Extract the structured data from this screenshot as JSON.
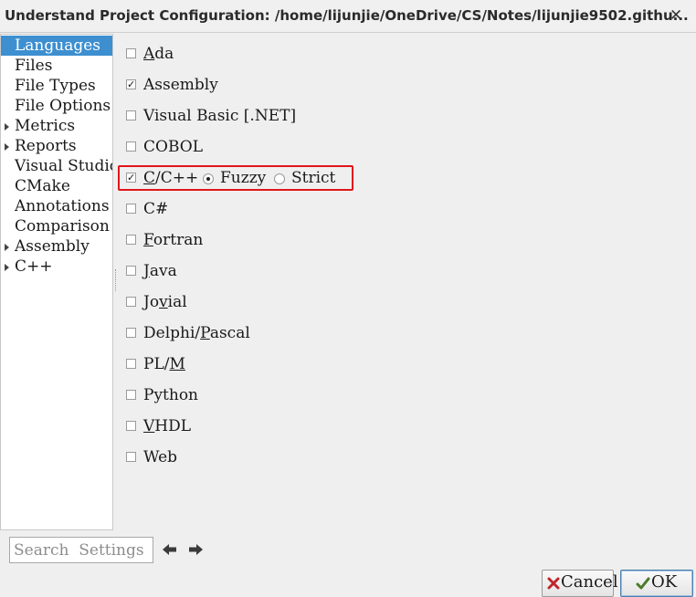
{
  "window": {
    "title": "Understand Project Configuration: /home/lijunjie/OneDrive/CS/Notes/lijunjie9502.githu..."
  },
  "sidebar": {
    "items": [
      {
        "label": "Languages",
        "selected": true,
        "expandable": false
      },
      {
        "label": "Files",
        "selected": false,
        "expandable": false
      },
      {
        "label": "File  Types",
        "selected": false,
        "expandable": false
      },
      {
        "label": "File  Options",
        "selected": false,
        "expandable": false
      },
      {
        "label": "Metrics",
        "selected": false,
        "expandable": true
      },
      {
        "label": "Reports",
        "selected": false,
        "expandable": true
      },
      {
        "label": "Visual  Studio",
        "selected": false,
        "expandable": false
      },
      {
        "label": "CMake",
        "selected": false,
        "expandable": false
      },
      {
        "label": "Annotations",
        "selected": false,
        "expandable": false
      },
      {
        "label": "Comparison",
        "selected": false,
        "expandable": false
      },
      {
        "label": "Assembly",
        "selected": false,
        "expandable": true
      },
      {
        "label": "C++",
        "selected": false,
        "expandable": true
      }
    ]
  },
  "languages": [
    {
      "label": "Ada",
      "checked": false
    },
    {
      "label": "Assembly",
      "checked": true
    },
    {
      "label": "Visual  Basic  [.NET]",
      "checked": false
    },
    {
      "label": "COBOL",
      "checked": false
    },
    {
      "label": "C/C++",
      "checked": true
    },
    {
      "label": "C#",
      "checked": false
    },
    {
      "label": "Fortran",
      "checked": false
    },
    {
      "label": "Java",
      "checked": false
    },
    {
      "label": "Jovial",
      "checked": false
    },
    {
      "label": "Delphi/Pascal",
      "checked": false
    },
    {
      "label": "PL/M",
      "checked": false
    },
    {
      "label": "Python",
      "checked": false
    },
    {
      "label": "VHDL",
      "checked": false
    },
    {
      "label": "Web",
      "checked": false
    }
  ],
  "cpp_mode": {
    "options": [
      "Fuzzy",
      "Strict"
    ],
    "selected": "Fuzzy"
  },
  "search": {
    "placeholder": "Search  Settings",
    "value": ""
  },
  "buttons": {
    "cancel": "Cancel",
    "ok": "OK"
  },
  "colors": {
    "selection": "#3d8fd0",
    "highlight": "#e0151b"
  }
}
